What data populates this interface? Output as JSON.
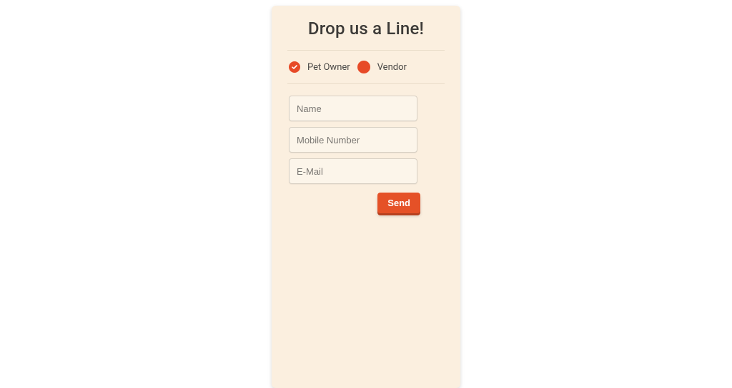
{
  "title": "Drop us a Line!",
  "radios": {
    "pet_owner": {
      "label": "Pet Owner",
      "selected": true
    },
    "vendor": {
      "label": "Vendor",
      "selected": false
    }
  },
  "fields": {
    "name": {
      "placeholder": "Name",
      "value": ""
    },
    "mobile": {
      "placeholder": "Mobile Number",
      "value": ""
    },
    "email": {
      "placeholder": "E-Mail",
      "value": ""
    }
  },
  "actions": {
    "send_label": "Send"
  },
  "colors": {
    "accent": "#e74a27",
    "card_bg": "#fbefdf"
  }
}
